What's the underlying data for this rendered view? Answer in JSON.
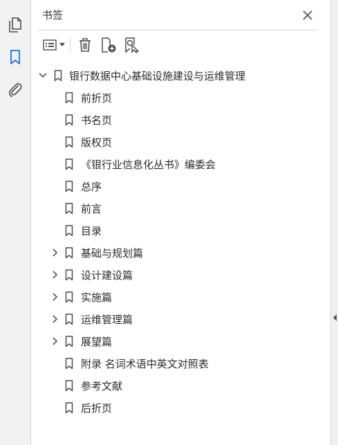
{
  "rail": {
    "pages_icon": "pages-thumbnail-icon",
    "bookmarks_icon": "bookmark-icon",
    "attachments_icon": "paperclip-icon"
  },
  "panel": {
    "title": "书签",
    "close_icon": "close-icon"
  },
  "toolbar": {
    "options_icon": "options-menu-icon",
    "dropdown_icon": "chevron-down-icon",
    "delete_icon": "trash-icon",
    "new_bookmark_icon": "new-bookmark-icon",
    "find_bookmark_icon": "find-current-bookmark-icon"
  },
  "bookmarks": {
    "root": {
      "label": "银行数据中心基础设施建设与运维管理",
      "expanded": true
    },
    "children": [
      {
        "label": "前折页",
        "has_children": false
      },
      {
        "label": "书名页",
        "has_children": false
      },
      {
        "label": "版权页",
        "has_children": false
      },
      {
        "label": "《银行业信息化丛书》编委会",
        "has_children": false
      },
      {
        "label": "总序",
        "has_children": false
      },
      {
        "label": "前言",
        "has_children": false
      },
      {
        "label": "目录",
        "has_children": false
      },
      {
        "label": "基础与规划篇",
        "has_children": true
      },
      {
        "label": "设计建设篇",
        "has_children": true
      },
      {
        "label": "实施篇",
        "has_children": true
      },
      {
        "label": "运维管理篇",
        "has_children": true
      },
      {
        "label": "展望篇",
        "has_children": true
      },
      {
        "label": "附录  名词术语中英文对照表",
        "has_children": false
      },
      {
        "label": "参考文献",
        "has_children": false
      },
      {
        "label": "后折页",
        "has_children": false
      }
    ]
  },
  "colors": {
    "accent": "#1473e6",
    "icon": "#4b4b4b",
    "rail_bg": "#f2f2f2"
  }
}
